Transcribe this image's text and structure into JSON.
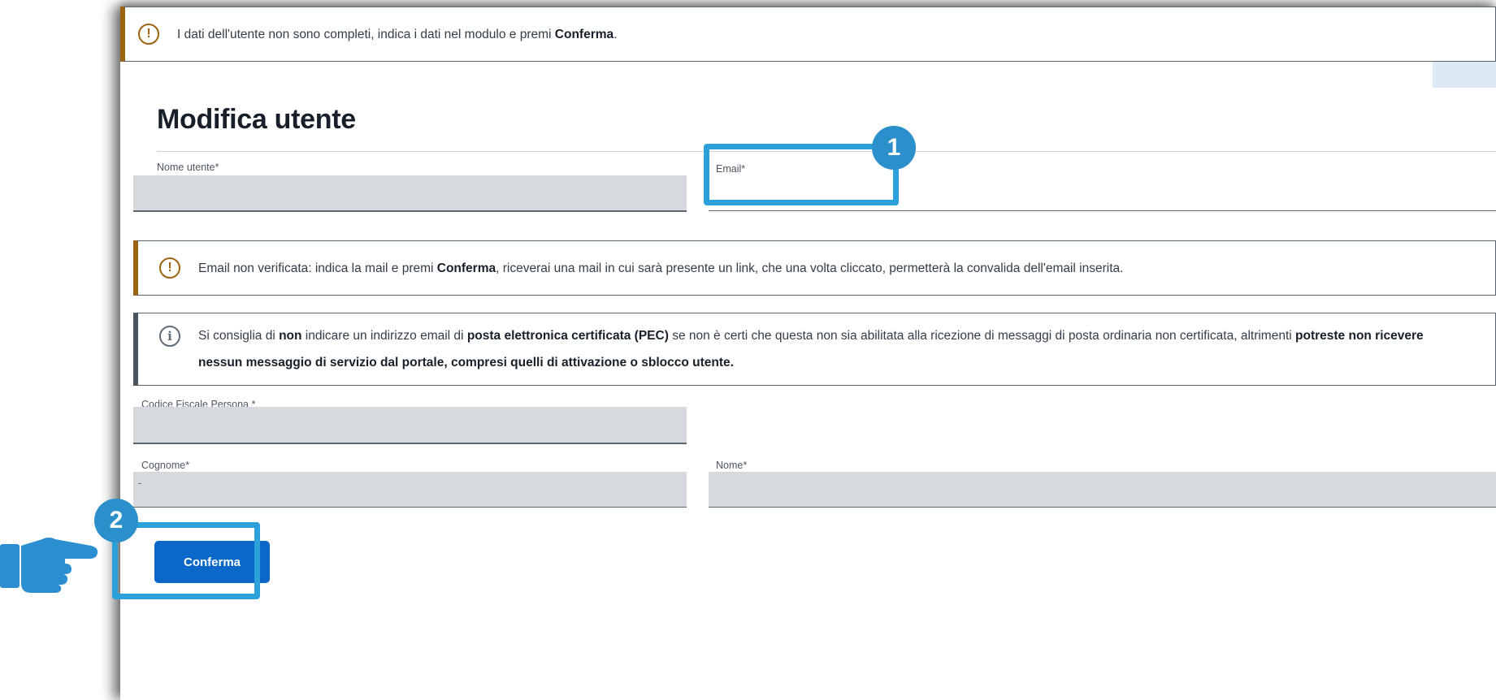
{
  "top_alert": {
    "text_before": "I dati dell'utente non sono completi, indica i dati nel modulo e premi ",
    "text_bold": "Conferma",
    "text_after": "."
  },
  "form": {
    "title": "Modifica utente",
    "username": {
      "label": "Nome utente*",
      "value": ""
    },
    "email": {
      "label": "Email*",
      "value": ""
    },
    "fiscal_code": {
      "label": "Codice Fiscale Persona *",
      "value": ""
    },
    "surname": {
      "label": "Cognome*",
      "value": "-"
    },
    "name": {
      "label": "Nome*",
      "value": ""
    }
  },
  "email_alert": {
    "text_1": "Email non verificata: indica la mail e premi ",
    "bold_1": "Conferma",
    "text_2": ", riceverai una mail in cui sarà presente un link, che una volta cliccato, permetterà la convalida dell'email inserita."
  },
  "pec_info": {
    "text_1": "Si consiglia di ",
    "bold_1": "non",
    "text_2": " indicare un indirizzo email di ",
    "bold_2": "posta elettronica certificata (PEC)",
    "text_3": " se non è certi che questa non sia abilitata alla ricezione di messaggi di posta ordinaria non certificata, altrimenti ",
    "bold_3": "potreste non ricevere nessun messaggio di servizio dal portale, compresi quelli di attivazione o sblocco utente."
  },
  "confirm_button": {
    "label": "Conferma"
  },
  "annotations": {
    "step_1": "1",
    "step_2": "2",
    "highlight_color": "#2ca0d8",
    "badge_color": "#2a8fca"
  },
  "icons": {
    "warning": "exclamation-circle",
    "info": "info-circle",
    "pointer": "pointing-hand"
  },
  "colors": {
    "warning_accent": "#9c6410",
    "info_accent": "#4a5562",
    "primary_button": "#0b67c8",
    "field_background": "#d6dade"
  }
}
